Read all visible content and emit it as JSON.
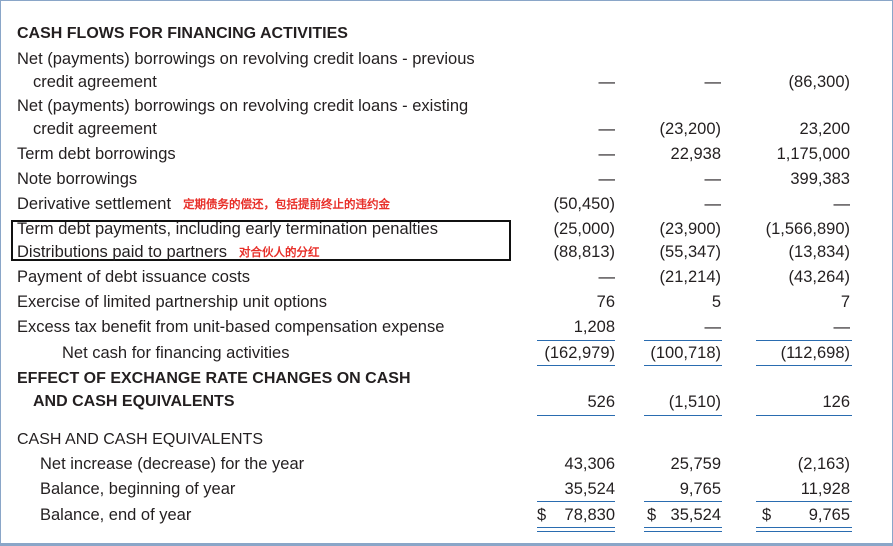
{
  "financing": {
    "header": "CASH FLOWS FOR FINANCING ACTIVITIES",
    "rows": [
      {
        "label_1": "Net (payments) borrowings on revolving credit loans - previous",
        "label_2": "credit agreement",
        "v1": "—",
        "v2": "—",
        "v3": "(86,300)"
      },
      {
        "label_1": "Net (payments) borrowings on revolving credit loans - existing",
        "label_2": "credit agreement",
        "v1": "—",
        "v2": "(23,200)",
        "v3": "23,200"
      },
      {
        "label": "Term debt borrowings",
        "v1": "—",
        "v2": "22,938",
        "v3": "1,175,000"
      },
      {
        "label": "Note borrowings",
        "v1": "—",
        "v2": "—",
        "v3": "399,383"
      },
      {
        "label": "Derivative settlement",
        "note": "定期债务的偿还，包括提前终止的违约金",
        "v1": "(50,450)",
        "v2": "—",
        "v3": "—"
      },
      {
        "label": "Term debt payments, including early termination penalties",
        "v1": "(25,000)",
        "v2": "(23,900)",
        "v3": "(1,566,890)"
      },
      {
        "label": "Distributions paid to partners",
        "note": "对合伙人的分红",
        "v1": "(88,813)",
        "v2": "(55,347)",
        "v3": "(13,834)"
      },
      {
        "label": "Payment of debt issuance costs",
        "v1": "—",
        "v2": "(21,214)",
        "v3": "(43,264)"
      },
      {
        "label": "Exercise of limited partnership unit options",
        "v1": "76",
        "v2": "5",
        "v3": "7"
      },
      {
        "label": "Excess tax benefit from unit-based compensation expense",
        "v1": "1,208",
        "v2": "—",
        "v3": "—"
      }
    ],
    "net": {
      "label": "Net cash for financing activities",
      "v1": "(162,979)",
      "v2": "(100,718)",
      "v3": "(112,698)"
    }
  },
  "fx": {
    "label_1": "EFFECT OF EXCHANGE RATE CHANGES ON CASH",
    "label_2": "AND CASH EQUIVALENTS",
    "v1": "526",
    "v2": "(1,510)",
    "v3": "126"
  },
  "cash": {
    "header": "CASH AND CASH EQUIVALENTS",
    "rows": [
      {
        "label": "Net increase (decrease) for the year",
        "v1": "43,306",
        "v2": "25,759",
        "v3": "(2,163)"
      },
      {
        "label": "Balance, beginning of year",
        "v1": "35,524",
        "v2": "9,765",
        "v3": "11,928"
      },
      {
        "label": "Balance, end of year",
        "dollar": "$",
        "v1": "78,830",
        "v2": "35,524",
        "v3": "9,765"
      }
    ]
  },
  "colors": {
    "rule": "#2a6cb0",
    "frame": "#8aa6c8",
    "annotation": "#e8302a",
    "highlight_box": "#111111"
  }
}
